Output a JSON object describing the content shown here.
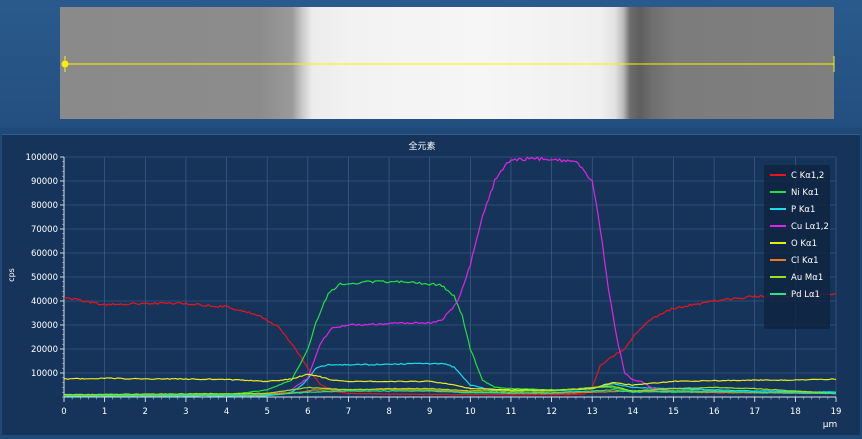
{
  "colors": {
    "background": "#1f4a78",
    "plot_background": "#163459",
    "grid": "#3f6791",
    "scan_line": "#ffee00"
  },
  "chart_data": {
    "type": "line",
    "title": "全元素",
    "xlabel": "μm",
    "ylabel": "cps",
    "xlim": [
      0,
      19
    ],
    "ylim": [
      0,
      100000
    ],
    "x_ticks": [
      0,
      1,
      2,
      3,
      4,
      5,
      6,
      7,
      8,
      9,
      10,
      11,
      12,
      13,
      14,
      15,
      16,
      17,
      18,
      19
    ],
    "y_ticks": [
      10000,
      20000,
      30000,
      40000,
      50000,
      60000,
      70000,
      80000,
      90000,
      100000
    ],
    "grid": true,
    "legend_position": "top-right",
    "series": [
      {
        "name": "C Kα1,2",
        "color": "#e8141e",
        "points": [
          [
            0,
            41500
          ],
          [
            0.5,
            40000
          ],
          [
            1,
            38500
          ],
          [
            2,
            39000
          ],
          [
            3,
            39000
          ],
          [
            4,
            37500
          ],
          [
            4.8,
            34000
          ],
          [
            5.3,
            29000
          ],
          [
            5.7,
            20000
          ],
          [
            6,
            12000
          ],
          [
            6.3,
            5500
          ],
          [
            6.6,
            2500
          ],
          [
            7,
            1500
          ],
          [
            8,
            1200
          ],
          [
            10,
            1000
          ],
          [
            12,
            1000
          ],
          [
            12.8,
            1200
          ],
          [
            13,
            4000
          ],
          [
            13.2,
            13000
          ],
          [
            13.5,
            17000
          ],
          [
            13.8,
            20000
          ],
          [
            14,
            25000
          ],
          [
            14.4,
            32000
          ],
          [
            15,
            37000
          ],
          [
            16,
            40000
          ],
          [
            17,
            42000
          ],
          [
            18,
            42000
          ],
          [
            19,
            43000
          ]
        ]
      },
      {
        "name": "Ni Kα1",
        "color": "#22e044",
        "points": [
          [
            0,
            500
          ],
          [
            4,
            800
          ],
          [
            5,
            3000
          ],
          [
            5.6,
            7000
          ],
          [
            6,
            20000
          ],
          [
            6.2,
            31000
          ],
          [
            6.5,
            43000
          ],
          [
            6.8,
            47000
          ],
          [
            7.5,
            48000
          ],
          [
            8.5,
            48000
          ],
          [
            9.3,
            46500
          ],
          [
            9.6,
            42000
          ],
          [
            9.8,
            34000
          ],
          [
            10,
            20000
          ],
          [
            10.3,
            7000
          ],
          [
            10.6,
            4000
          ],
          [
            11,
            3500
          ],
          [
            12,
            3000
          ],
          [
            12.8,
            3200
          ],
          [
            13.2,
            4500
          ],
          [
            13.6,
            3500
          ],
          [
            14,
            2500
          ],
          [
            15,
            2000
          ],
          [
            19,
            1500
          ]
        ]
      },
      {
        "name": "P Kα1",
        "color": "#19dcec",
        "points": [
          [
            0,
            500
          ],
          [
            5,
            500
          ],
          [
            5.6,
            2000
          ],
          [
            5.9,
            5500
          ],
          [
            6.2,
            12000
          ],
          [
            6.5,
            13500
          ],
          [
            7.5,
            13500
          ],
          [
            8.5,
            13800
          ],
          [
            9.3,
            14000
          ],
          [
            9.6,
            12500
          ],
          [
            10,
            5000
          ],
          [
            10.5,
            3000
          ],
          [
            12,
            2500
          ],
          [
            13,
            3500
          ],
          [
            13.5,
            5500
          ],
          [
            14,
            4000
          ],
          [
            15,
            3500
          ],
          [
            16,
            3000
          ],
          [
            17,
            2500
          ],
          [
            19,
            2000
          ]
        ]
      },
      {
        "name": "Cu Lα1,2",
        "color": "#e024e6",
        "points": [
          [
            0,
            800
          ],
          [
            4,
            1000
          ],
          [
            5,
            1500
          ],
          [
            5.6,
            3000
          ],
          [
            6,
            8000
          ],
          [
            6.3,
            22000
          ],
          [
            6.6,
            29000
          ],
          [
            7,
            30000
          ],
          [
            8,
            30500
          ],
          [
            9,
            31000
          ],
          [
            9.3,
            32000
          ],
          [
            9.7,
            40000
          ],
          [
            10,
            55000
          ],
          [
            10.3,
            75000
          ],
          [
            10.6,
            90000
          ],
          [
            10.9,
            98000
          ],
          [
            11.5,
            99500
          ],
          [
            12,
            99000
          ],
          [
            12.6,
            98000
          ],
          [
            13,
            90000
          ],
          [
            13.2,
            70000
          ],
          [
            13.4,
            45000
          ],
          [
            13.6,
            25000
          ],
          [
            13.8,
            10000
          ],
          [
            14,
            7000
          ],
          [
            14.2,
            6500
          ],
          [
            14.5,
            3500
          ],
          [
            15,
            2500
          ],
          [
            16,
            2000
          ],
          [
            19,
            1500
          ]
        ]
      },
      {
        "name": "O Kα1",
        "color": "#e8ea1e",
        "points": [
          [
            0,
            7500
          ],
          [
            1,
            7800
          ],
          [
            2,
            7500
          ],
          [
            3,
            7500
          ],
          [
            4,
            7300
          ],
          [
            5,
            6500
          ],
          [
            5.6,
            7500
          ],
          [
            6,
            9500
          ],
          [
            6.3,
            8500
          ],
          [
            6.6,
            7000
          ],
          [
            7,
            6500
          ],
          [
            8,
            6500
          ],
          [
            9,
            6500
          ],
          [
            9.6,
            5000
          ],
          [
            10,
            3500
          ],
          [
            11,
            3000
          ],
          [
            12,
            2800
          ],
          [
            13,
            3500
          ],
          [
            13.5,
            6000
          ],
          [
            14,
            5000
          ],
          [
            15,
            6500
          ],
          [
            16,
            6800
          ],
          [
            17,
            7000
          ],
          [
            18,
            7000
          ],
          [
            19,
            7500
          ]
        ]
      },
      {
        "name": "Cl Kα1",
        "color": "#ee7722",
        "points": [
          [
            0,
            800
          ],
          [
            5,
            1200
          ],
          [
            5.8,
            2000
          ],
          [
            6.2,
            3000
          ],
          [
            7,
            3000
          ],
          [
            8,
            3200
          ],
          [
            9,
            3000
          ],
          [
            10,
            2000
          ],
          [
            11,
            1500
          ],
          [
            12,
            1500
          ],
          [
            13,
            2000
          ],
          [
            14,
            2500
          ],
          [
            15,
            2500
          ],
          [
            16,
            2000
          ],
          [
            19,
            1500
          ]
        ]
      },
      {
        "name": "Au Mα1",
        "color": "#9be218",
        "points": [
          [
            0,
            1000
          ],
          [
            5,
            1500
          ],
          [
            6,
            4000
          ],
          [
            7,
            3000
          ],
          [
            8,
            3500
          ],
          [
            9,
            3500
          ],
          [
            10,
            2500
          ],
          [
            11,
            2500
          ],
          [
            12,
            2500
          ],
          [
            13,
            4000
          ],
          [
            13.5,
            4500
          ],
          [
            14,
            2500
          ],
          [
            15,
            3500
          ],
          [
            16,
            4000
          ],
          [
            17,
            3500
          ],
          [
            18,
            2500
          ],
          [
            19,
            1500
          ]
        ]
      },
      {
        "name": "Pd Lα1",
        "color": "#22e688",
        "points": [
          [
            0,
            500
          ],
          [
            5,
            800
          ],
          [
            6,
            2000
          ],
          [
            7,
            2500
          ],
          [
            8,
            2500
          ],
          [
            9,
            2500
          ],
          [
            10,
            1800
          ],
          [
            11,
            1800
          ],
          [
            12,
            1800
          ],
          [
            13,
            2500
          ],
          [
            13.5,
            3000
          ],
          [
            14,
            2000
          ],
          [
            15,
            2500
          ],
          [
            16,
            2500
          ],
          [
            17,
            2000
          ],
          [
            19,
            1500
          ]
        ]
      }
    ]
  }
}
